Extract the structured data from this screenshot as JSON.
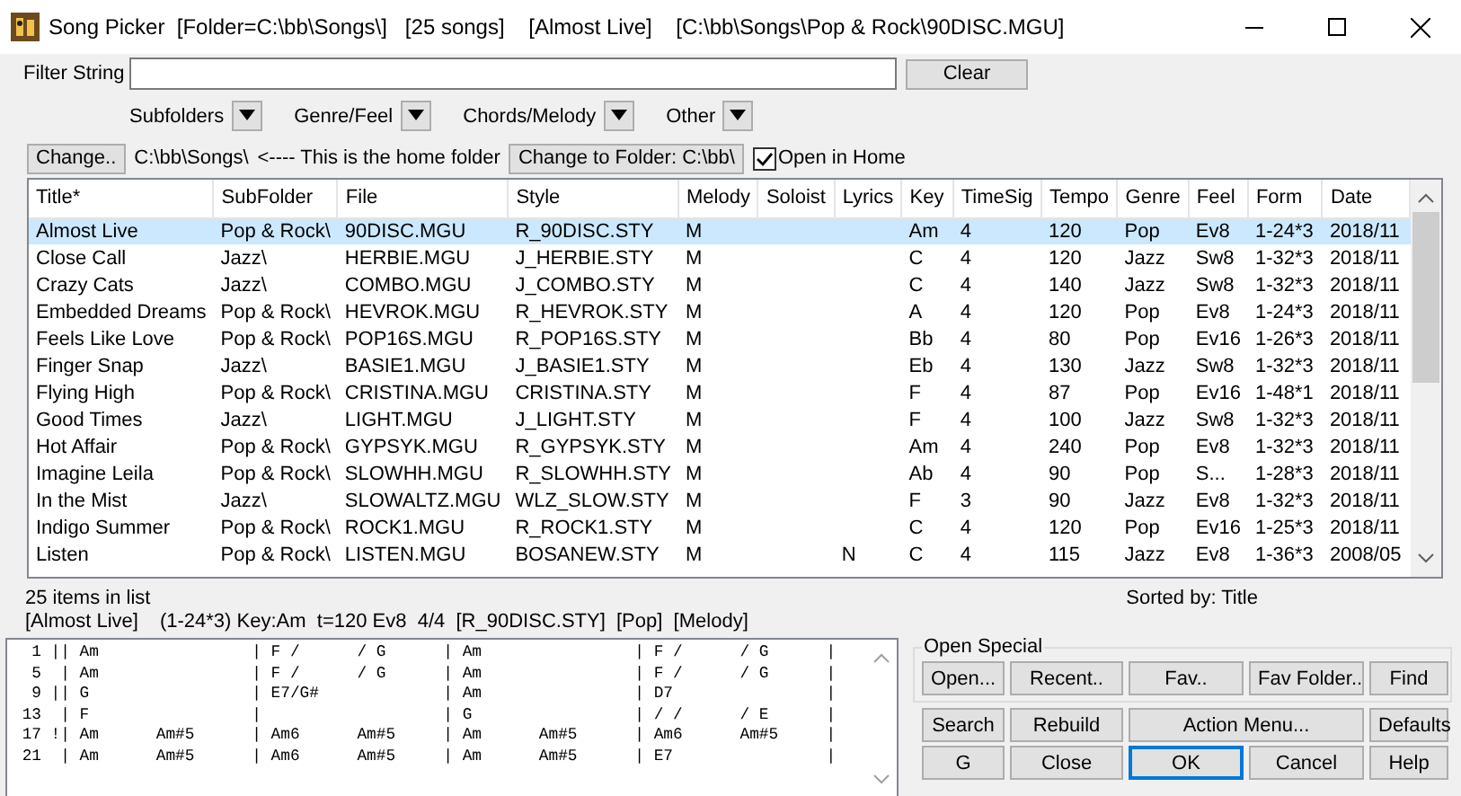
{
  "window": {
    "title": "Song Picker  [Folder=C:\\bb\\Songs\\]   [25 songs]    [Almost Live]    [C:\\bb\\Songs\\Pop & Rock\\90DISC.MGU]"
  },
  "filter": {
    "label": "Filter String",
    "clear_button": "Clear"
  },
  "dropdowns": [
    {
      "label": "Subfolders"
    },
    {
      "label": "Genre/Feel"
    },
    {
      "label": "Chords/Melody"
    },
    {
      "label": "Other"
    }
  ],
  "folder_bar": {
    "change_button": "Change..",
    "path": "C:\\bb\\Songs\\",
    "note": "<---- This is the home folder",
    "change_to_button": "Change to Folder: C:\\bb\\",
    "open_in_home": {
      "label": "Open in Home",
      "checked": true
    }
  },
  "table": {
    "columns": [
      "Title*",
      "SubFolder",
      "File",
      "Style",
      "Melody",
      "Soloist",
      "Lyrics",
      "Key",
      "TimeSig",
      "Tempo",
      "Genre",
      "Feel",
      "Form",
      "Date"
    ],
    "rows": [
      {
        "selected": true,
        "cells": [
          "Almost Live",
          "Pop & Rock\\",
          "90DISC.MGU",
          "R_90DISC.STY",
          "M",
          "",
          "",
          "Am",
          "4",
          "120",
          "Pop",
          "Ev8",
          "1-24*3",
          "2018/11"
        ]
      },
      {
        "selected": false,
        "cells": [
          "Close Call",
          "Jazz\\",
          "HERBIE.MGU",
          "J_HERBIE.STY",
          "M",
          "",
          "",
          "C",
          "4",
          "120",
          "Jazz",
          "Sw8",
          "1-32*3",
          "2018/11"
        ]
      },
      {
        "selected": false,
        "cells": [
          "Crazy Cats",
          "Jazz\\",
          "COMBO.MGU",
          "J_COMBO.STY",
          "M",
          "",
          "",
          "C",
          "4",
          "140",
          "Jazz",
          "Sw8",
          "1-32*3",
          "2018/11"
        ]
      },
      {
        "selected": false,
        "cells": [
          "Embedded Dreams",
          "Pop & Rock\\",
          "HEVROK.MGU",
          "R_HEVROK.STY",
          "M",
          "",
          "",
          "A",
          "4",
          "120",
          "Pop",
          "Ev8",
          "1-24*3",
          "2018/11"
        ]
      },
      {
        "selected": false,
        "cells": [
          "Feels Like Love",
          "Pop & Rock\\",
          "POP16S.MGU",
          "R_POP16S.STY",
          "M",
          "",
          "",
          "Bb",
          "4",
          "80",
          "Pop",
          "Ev16",
          "1-26*3",
          "2018/11"
        ]
      },
      {
        "selected": false,
        "cells": [
          "Finger Snap",
          "Jazz\\",
          "BASIE1.MGU",
          "J_BASIE1.STY",
          "M",
          "",
          "",
          "Eb",
          "4",
          "130",
          "Jazz",
          "Sw8",
          "1-32*3",
          "2018/11"
        ]
      },
      {
        "selected": false,
        "cells": [
          "Flying High",
          "Pop & Rock\\",
          "CRISTINA.MGU",
          "CRISTINA.STY",
          "M",
          "",
          "",
          "F",
          "4",
          "87",
          "Pop",
          "Ev16",
          "1-48*1",
          "2018/11"
        ]
      },
      {
        "selected": false,
        "cells": [
          "Good Times",
          "Jazz\\",
          "LIGHT.MGU",
          "J_LIGHT.STY",
          "M",
          "",
          "",
          "F",
          "4",
          "100",
          "Jazz",
          "Sw8",
          "1-32*3",
          "2018/11"
        ]
      },
      {
        "selected": false,
        "cells": [
          "Hot Affair",
          "Pop & Rock\\",
          "GYPSYK.MGU",
          "R_GYPSYK.STY",
          "M",
          "",
          "",
          "Am",
          "4",
          "240",
          "Pop",
          "Ev8",
          "1-32*3",
          "2018/11"
        ]
      },
      {
        "selected": false,
        "cells": [
          "Imagine Leila",
          "Pop & Rock\\",
          "SLOWHH.MGU",
          "R_SLOWHH.STY",
          "M",
          "",
          "",
          "Ab",
          "4",
          "90",
          "Pop",
          "S...",
          "1-28*3",
          "2018/11"
        ]
      },
      {
        "selected": false,
        "cells": [
          "In the Mist",
          "Jazz\\",
          "SLOWALTZ.MGU",
          "WLZ_SLOW.STY",
          "M",
          "",
          "",
          "F",
          "3",
          "90",
          "Jazz",
          "Ev8",
          "1-32*3",
          "2018/11"
        ]
      },
      {
        "selected": false,
        "cells": [
          "Indigo Summer",
          "Pop & Rock\\",
          "ROCK1.MGU",
          "R_ROCK1.STY",
          "M",
          "",
          "",
          "C",
          "4",
          "120",
          "Pop",
          "Ev16",
          "1-25*3",
          "2018/11"
        ]
      },
      {
        "selected": false,
        "cells": [
          "Listen",
          "Pop & Rock\\",
          "LISTEN.MGU",
          "BOSANEW.STY",
          "M",
          "",
          "N",
          "C",
          "4",
          "115",
          "Jazz",
          "Ev8",
          "1-36*3",
          "2008/05"
        ]
      }
    ]
  },
  "status": {
    "count": "25 items in list",
    "sorted": "Sorted by: Title",
    "song": "[Almost Live]",
    "summary": "(1-24*3) Key:Am  t=120 Ev8  4/4  [R_90DISC.STY]  [Pop]  [Melody]"
  },
  "chord_sheet": {
    "lines": [
      "  1 || Am                | F /      / G      | Am                | F /      / G      |",
      "  5  | Am                | F /      / G      | Am                | F /      / G      |",
      "  9 || G                 | E7/G#             | Am                | D7                |",
      " 13  | F                 |                   | G                 | / /      / E      |",
      " 17 !| Am      Am#5      | Am6      Am#5     | Am      Am#5      | Am6      Am#5     |",
      " 21  | Am      Am#5      | Am6      Am#5     | Am      Am#5      | E7                |"
    ]
  },
  "open_special": {
    "title": "Open Special",
    "buttons": [
      {
        "label": "Open...",
        "default": false
      },
      {
        "label": "Recent..",
        "default": false
      },
      {
        "label": "Fav..",
        "default": false
      },
      {
        "label": "Fav Folder..",
        "default": false
      },
      {
        "label": "Find",
        "default": false
      }
    ]
  },
  "action_rows": [
    [
      {
        "label": "Search",
        "default": false
      },
      {
        "label": "Rebuild",
        "default": false
      },
      {
        "label": "Action Menu...",
        "default": false
      },
      {
        "label": "Defaults",
        "default": false
      }
    ],
    [
      {
        "label": "G",
        "default": false
      },
      {
        "label": "Close",
        "default": false
      },
      {
        "label": "OK",
        "default": true
      },
      {
        "label": "Cancel",
        "default": false
      },
      {
        "label": "Help",
        "default": false
      }
    ]
  ]
}
